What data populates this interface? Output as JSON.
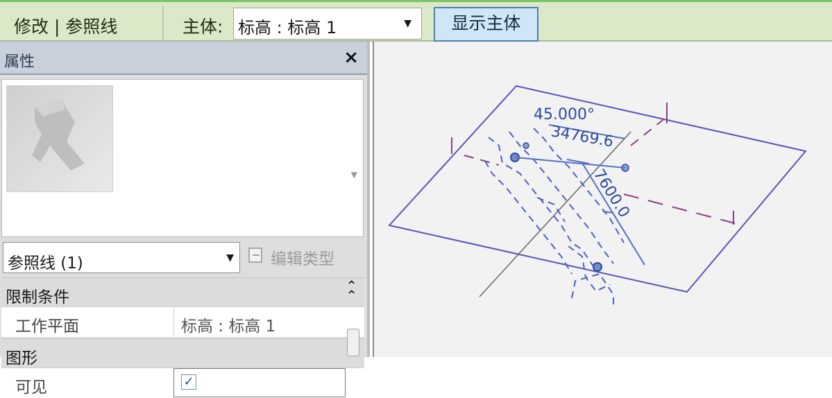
{
  "ribbon": {
    "context_tab": "修改 | 参照线",
    "host_label": "主体:",
    "host_value": "标高 : 标高 1",
    "show_host_button": "显示主体"
  },
  "properties": {
    "title": "属性",
    "close_symbol": "×",
    "type_selector": "参照线 (1)",
    "edit_type": "编辑类型",
    "sections": [
      {
        "name": "限制条件",
        "rows": [
          {
            "key": "工作平面",
            "value": "标高 : 标高 1"
          }
        ]
      },
      {
        "name": "图形",
        "rows": [
          {
            "key": "可见",
            "checked": true
          }
        ]
      }
    ]
  },
  "viewport": {
    "angle_dim": "45.000°",
    "length_dim": "34769.6",
    "offset_dim": "7600.0"
  },
  "colors": {
    "ribbon_bg": "#dbe9c9",
    "active_button": "#cfe6f6",
    "plane_line": "#5b54b8",
    "dim_text": "#2f4aa0",
    "ref_dash": "#8a3d86"
  }
}
